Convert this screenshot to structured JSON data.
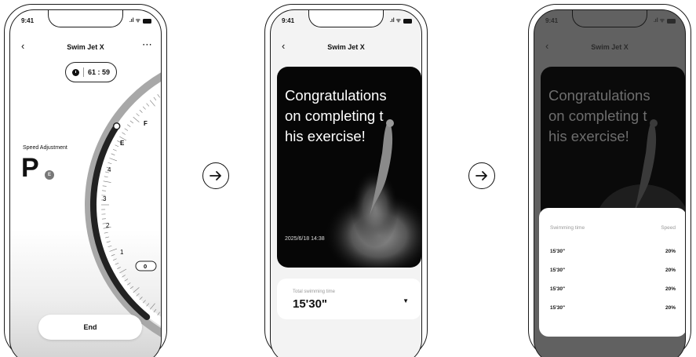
{
  "status_time": "9:41",
  "status_icons": ".ıl ᯤ",
  "nav": {
    "back": "‹",
    "title": "Swim Jet X",
    "more": "⋯"
  },
  "screen1": {
    "timer": "61 : 59",
    "speed_label": "Speed Adjustment",
    "gear": "P",
    "gear_badge": "E",
    "dial_labels": [
      "F",
      "E",
      "4",
      "3",
      "2",
      "1",
      "0"
    ],
    "end_button": "End"
  },
  "photo_card": {
    "message": "Congratulations on completing this exercise!",
    "date": "2025/6/18 14:38"
  },
  "total": {
    "label": "Total swimming time",
    "value": "15'30\"",
    "caret": "▼"
  },
  "sheet": {
    "col_time": "Swimming time",
    "col_speed": "Speed",
    "rows": [
      {
        "time": "15'30\"",
        "speed": "20%"
      },
      {
        "time": "15'30\"",
        "speed": "20%"
      },
      {
        "time": "15'30\"",
        "speed": "20%"
      },
      {
        "time": "15'30\"",
        "speed": "20%"
      }
    ]
  },
  "arrow": "→"
}
